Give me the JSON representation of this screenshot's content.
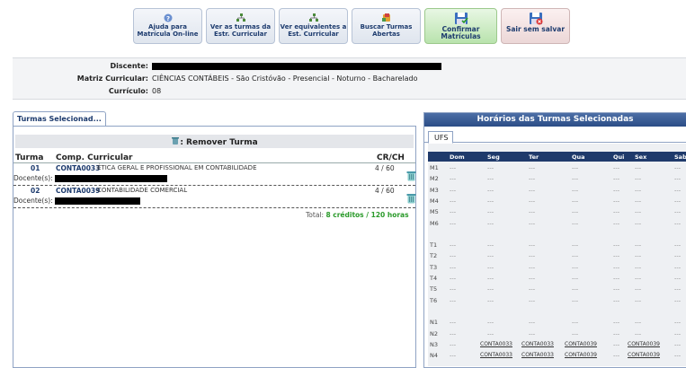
{
  "toolbar": {
    "buttons": [
      {
        "label": "Ajuda para Matrícula On-line",
        "icon": "help-icon"
      },
      {
        "label": "Ver as turmas da Estr. Curricular",
        "icon": "tree-icon"
      },
      {
        "label": "Ver equivalentes a Est. Curricular",
        "icon": "tree-icon"
      },
      {
        "label": "Buscar Turmas Abertas",
        "icon": "search-group-icon"
      },
      {
        "label": "Confirmar Matrículas",
        "icon": "save-icon"
      },
      {
        "label": "Sair sem salvar",
        "icon": "exit-save-icon"
      }
    ]
  },
  "info": {
    "discente_label": "Discente:",
    "matriz_label": "Matriz Curricular:",
    "matriz_value": "CIÊNCIAS CONTÁBEIS - São Cristóvão - Presencial - Noturno - Bacharelado",
    "curriculo_label": "Currículo:",
    "curriculo_value": "08"
  },
  "left": {
    "tab_label": "Turmas Selecionad...",
    "remove_label": ": Remover Turma",
    "headers": {
      "turma": "Turma",
      "comp": "Comp. Curricular",
      "crch": "CR/CH"
    },
    "rows": [
      {
        "turma": "01",
        "code": "CONTA0033",
        "name": "ÉTICA GERAL E PROFISSIONAL EM CONTABILIDADE",
        "crch": "4 / 60",
        "docente_label": "Docente(s):"
      },
      {
        "turma": "02",
        "code": "CONTA0039",
        "name": "CONTABILIDADE COMERCIAL",
        "crch": "4 / 60",
        "docente_label": "Docente(s):"
      }
    ],
    "total_prefix": "Total:",
    "total_value": "8 créditos / 120 horas"
  },
  "right": {
    "title": "Horários das Turmas Selecionadas",
    "tab": "UFS",
    "days": [
      "Dom",
      "Seg",
      "Ter",
      "Qua",
      "Qui",
      "Sex",
      "Sab"
    ],
    "slots": [
      "M1",
      "M2",
      "M3",
      "M4",
      "M5",
      "M6",
      "",
      "T1",
      "T2",
      "T3",
      "T4",
      "T5",
      "T6",
      "",
      "N1",
      "N2",
      "N3",
      "N4"
    ],
    "empty_cell": "---",
    "n3": [
      "---",
      "CONTA0033",
      "CONTA0033",
      "CONTA0039",
      "---",
      "CONTA0039",
      "---"
    ],
    "n4": [
      "---",
      "CONTA0033",
      "CONTA0033",
      "CONTA0039",
      "---",
      "CONTA0039",
      "---"
    ]
  }
}
